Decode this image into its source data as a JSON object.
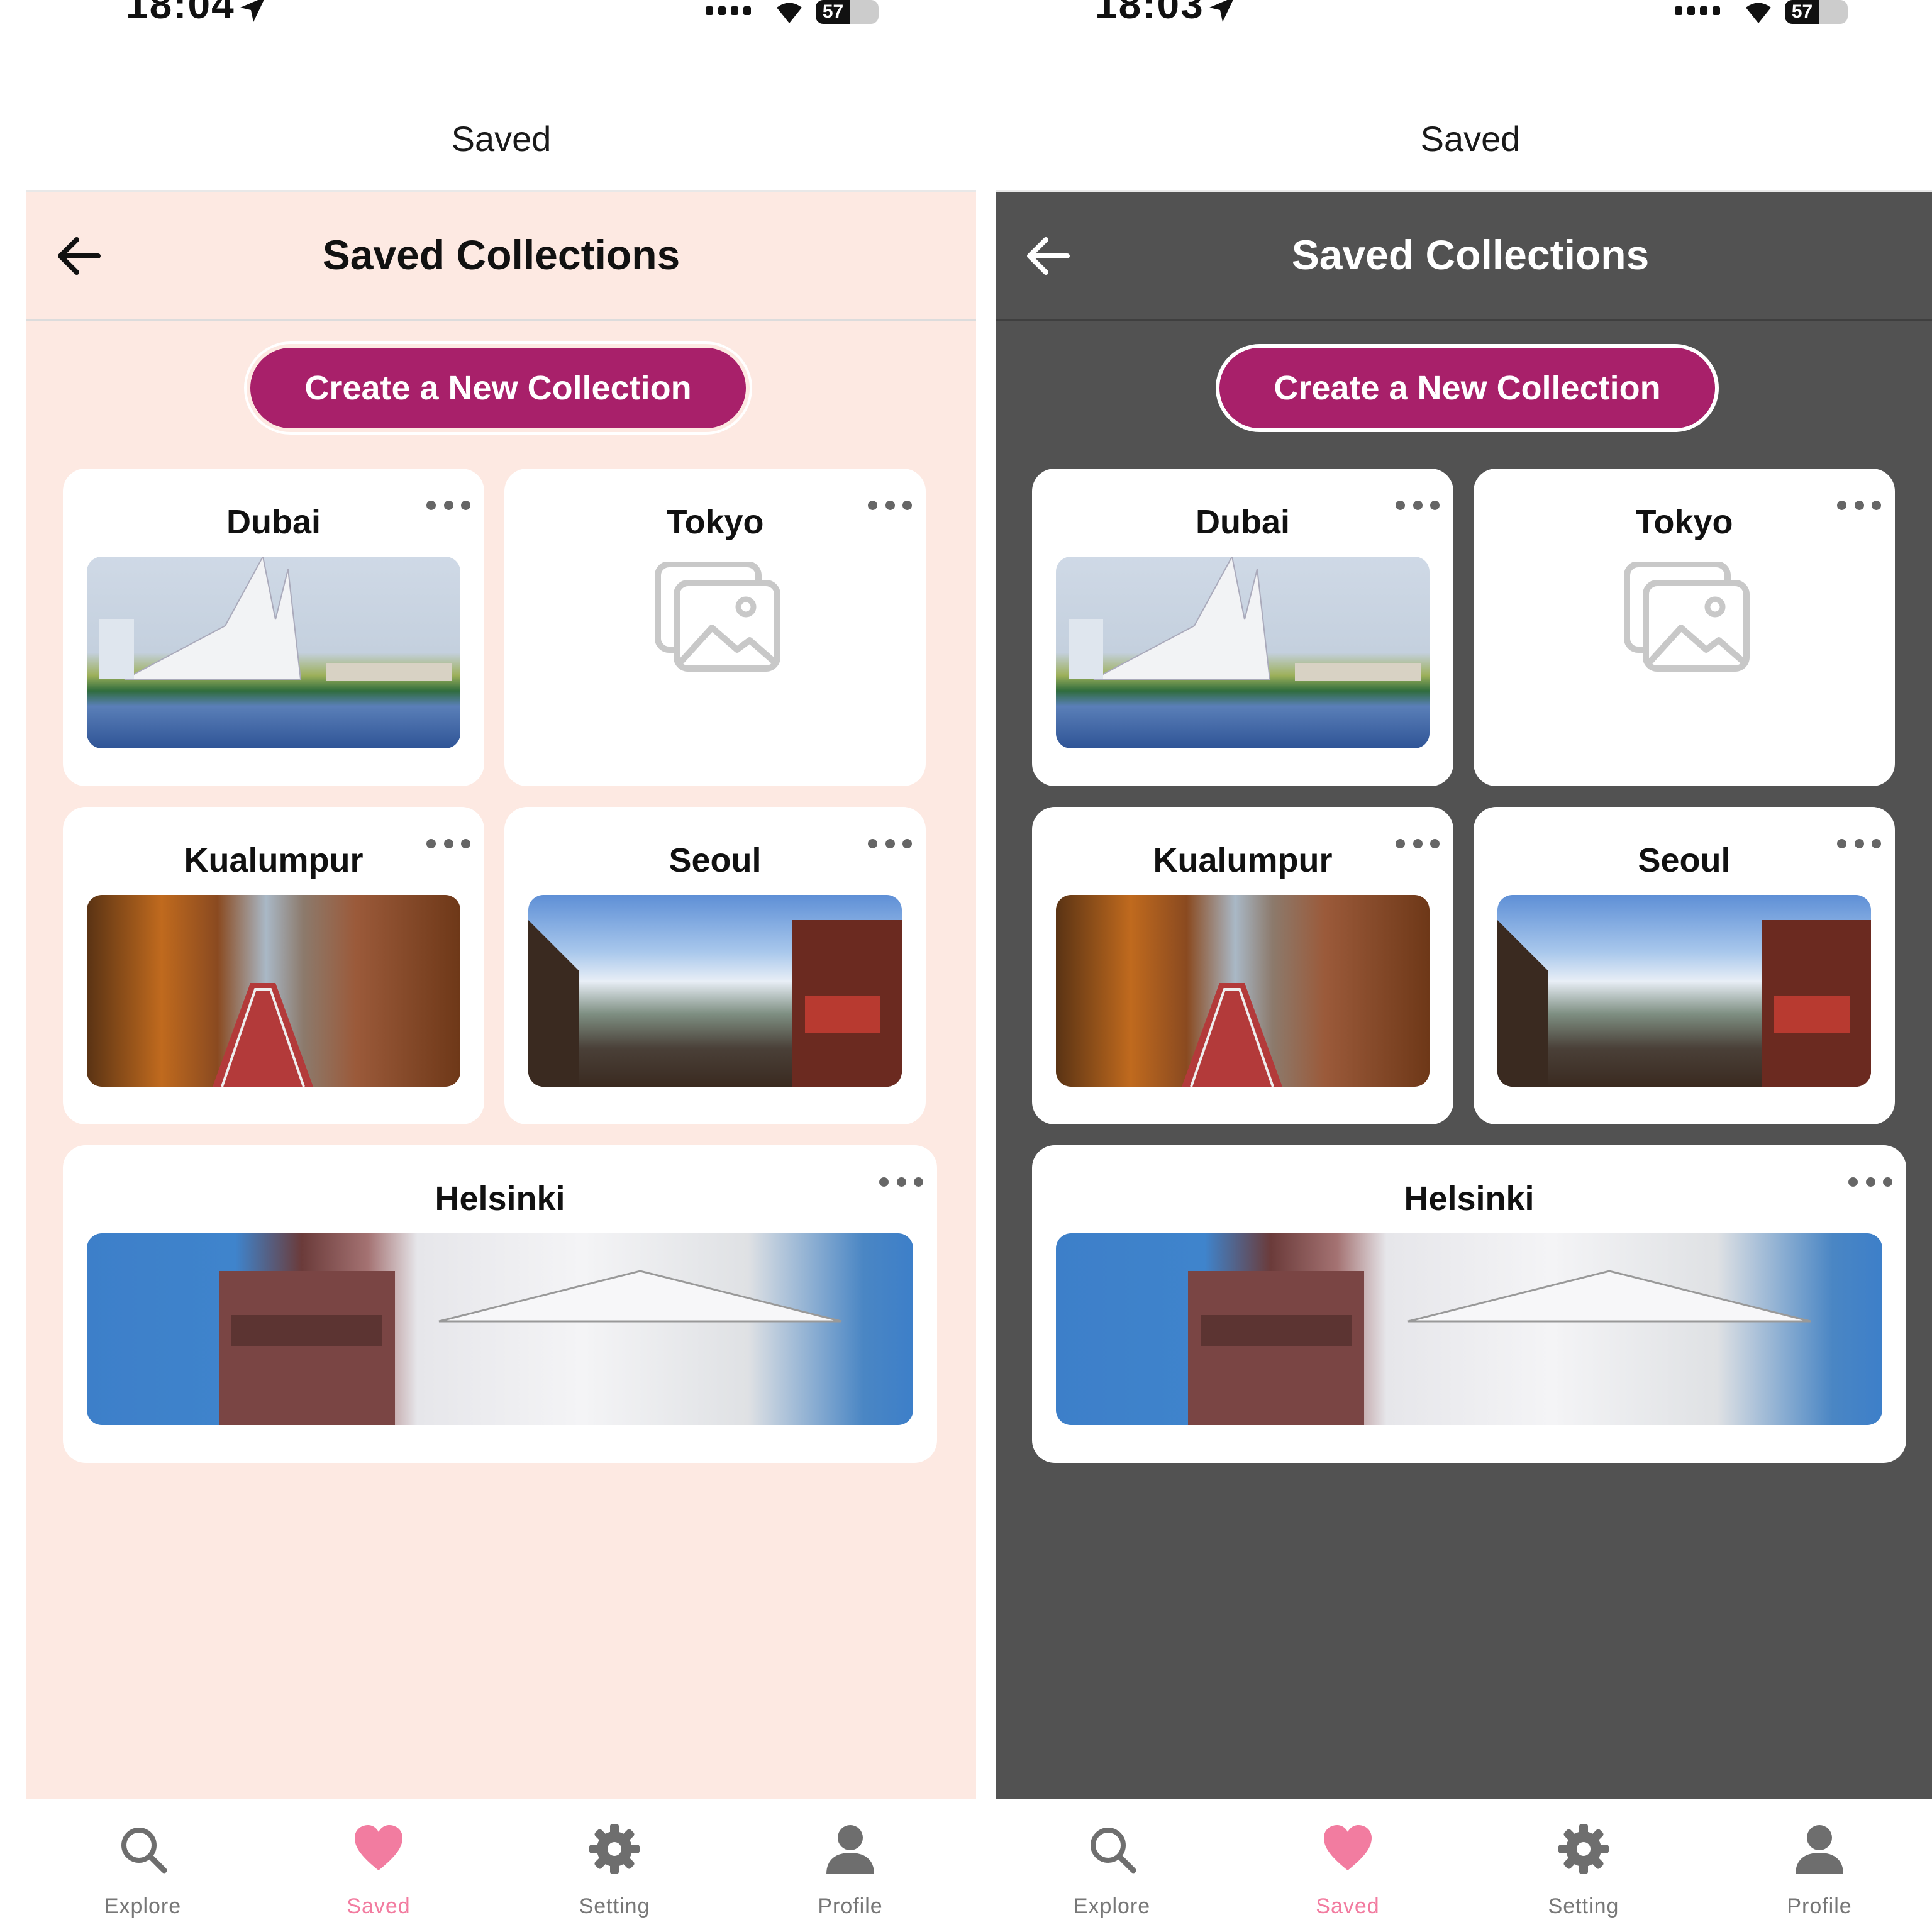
{
  "screens": [
    {
      "theme": "light",
      "status": {
        "time": "18:04",
        "battery": "57"
      },
      "topbar": {
        "title": "Saved"
      },
      "header": {
        "title": "Saved Collections"
      },
      "create_button": {
        "label": "Create a New Collection"
      },
      "collections": [
        {
          "name": "Dubai",
          "image": "dubai-photo"
        },
        {
          "name": "Tokyo",
          "image": "placeholder-image-icon"
        },
        {
          "name": "Kualumpur",
          "image": "kualalumpur-photo"
        },
        {
          "name": "Seoul",
          "image": "seoul-photo"
        },
        {
          "name": "Helsinki",
          "image": "helsinki-photo"
        }
      ],
      "tabs": [
        {
          "label": "Explore",
          "icon": "search-icon"
        },
        {
          "label": "Saved",
          "icon": "heart-icon",
          "active": true
        },
        {
          "label": "Setting",
          "icon": "gear-icon"
        },
        {
          "label": "Profile",
          "icon": "person-icon"
        }
      ]
    },
    {
      "theme": "dark",
      "status": {
        "time": "18:03",
        "battery": "57"
      },
      "topbar": {
        "title": "Saved"
      },
      "header": {
        "title": "Saved Collections"
      },
      "create_button": {
        "label": "Create a New Collection"
      },
      "collections": [
        {
          "name": "Dubai",
          "image": "dubai-photo"
        },
        {
          "name": "Tokyo",
          "image": "placeholder-image-icon"
        },
        {
          "name": "Kualumpur",
          "image": "kualalumpur-photo"
        },
        {
          "name": "Seoul",
          "image": "seoul-photo"
        },
        {
          "name": "Helsinki",
          "image": "helsinki-photo"
        }
      ],
      "tabs": [
        {
          "label": "Explore",
          "icon": "search-icon"
        },
        {
          "label": "Saved",
          "icon": "heart-icon",
          "active": true
        },
        {
          "label": "Setting",
          "icon": "gear-icon"
        },
        {
          "label": "Profile",
          "icon": "person-icon"
        }
      ]
    }
  ],
  "colors": {
    "accent": "#a8206a",
    "light_background": "#fde9e2",
    "dark_background": "#525252",
    "active_tab": "#f27ca0",
    "inactive_tab": "#777777"
  }
}
